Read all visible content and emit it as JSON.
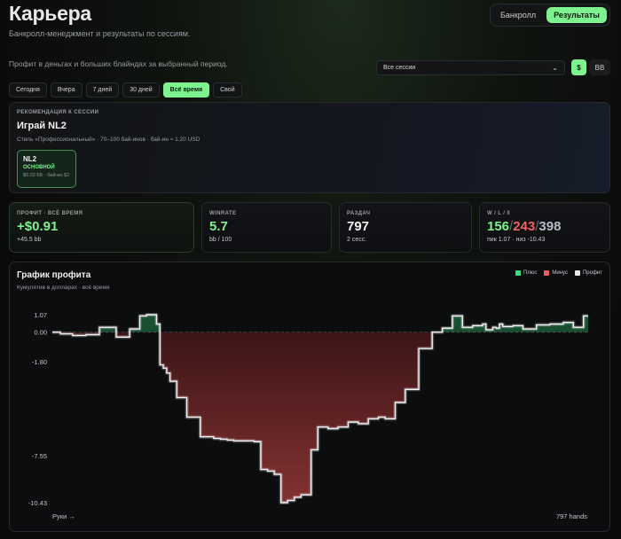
{
  "header": {
    "title": "Карьера",
    "subtitle": "Банкролл-менеджмент и результаты по сессиям.",
    "nav": [
      {
        "label": "Банкролл",
        "active": false
      },
      {
        "label": "Результаты",
        "active": true
      }
    ]
  },
  "filters": {
    "description": "Профит в деньгах и больших блайндах за выбранный период.",
    "session_select": "Все сессии",
    "units": {
      "dollar": "$",
      "bb": "BB",
      "selected": "$"
    },
    "periods": [
      {
        "label": "Сегодня",
        "active": false
      },
      {
        "label": "Вчера",
        "active": false
      },
      {
        "label": "7 дней",
        "active": false
      },
      {
        "label": "30 дней",
        "active": false
      },
      {
        "label": "Всё время",
        "active": true
      },
      {
        "label": "Свой",
        "active": false
      }
    ]
  },
  "recommendation": {
    "label": "РЕКОМЕНДАЦИЯ К СЕССИИ",
    "headline": "Играй NL2",
    "style": "Стиль «Профессиональный» · 70–100 бай-инов · бай-ин ≈ 1.20 USD",
    "limit": {
      "name": "NL2",
      "badge": "ОСНОВНОЙ",
      "blinds": "$0.02 ББ · бай-ин $2"
    }
  },
  "stats": {
    "profit": {
      "label": "ПРОФИТ · ВСЁ ВРЕМЯ",
      "value": "+$0.91",
      "sub": "+45.5 bb"
    },
    "winrate": {
      "label": "WINRATE",
      "value": "5.7",
      "sub": "bb / 100"
    },
    "hands": {
      "label": "РАЗДАЧ",
      "value": "797",
      "sub": "2 сесс."
    },
    "wl": {
      "label": "W / L / 0",
      "wins": "156",
      "losses": "243",
      "total": "398",
      "sep": "/",
      "sub": "пик 1.07 · низ -10.43"
    }
  },
  "chart_data": {
    "type": "line",
    "title": "График профита",
    "subtitle": "Кумулятив в долларах · всё время",
    "xlabel": "Руки →",
    "x_end_label": "797 hands",
    "legend": [
      {
        "name": "Плюс",
        "color": "#3ddc84"
      },
      {
        "name": "Минус",
        "color": "#f06262"
      },
      {
        "name": "Профит",
        "color": "#e8e8ea"
      }
    ],
    "ylim": [
      -10.43,
      1.07
    ],
    "yticks": [
      1.07,
      0.0,
      -1.8,
      -7.55,
      -10.43
    ],
    "ytick_labels": [
      "1.07",
      "0.00",
      "-1.80",
      "-7.55",
      "-10.43"
    ],
    "xlim": [
      0,
      797
    ],
    "x": [
      0,
      12,
      30,
      50,
      70,
      95,
      115,
      130,
      140,
      155,
      160,
      165,
      170,
      175,
      185,
      200,
      220,
      240,
      250,
      260,
      265,
      270,
      280,
      290,
      300,
      305,
      310,
      320,
      330,
      340,
      350,
      360,
      370,
      375,
      380,
      385,
      395,
      410,
      425,
      440,
      455,
      470,
      485,
      495,
      510,
      525,
      545,
      565,
      580,
      595,
      610,
      625,
      640,
      645,
      655,
      660,
      665,
      670,
      685,
      700,
      720,
      740,
      760,
      775,
      790,
      797
    ],
    "y": [
      0.0,
      -0.1,
      -0.2,
      -0.15,
      0.3,
      -0.3,
      0.2,
      1.0,
      1.07,
      0.5,
      -2.0,
      -2.2,
      -2.5,
      -3.0,
      -4.0,
      -5.2,
      -6.4,
      -6.5,
      -6.55,
      -6.6,
      -6.6,
      -6.65,
      -6.65,
      -6.65,
      -6.7,
      -6.7,
      -8.4,
      -8.5,
      -8.7,
      -10.43,
      -10.3,
      -10.1,
      -9.95,
      -9.95,
      -9.95,
      -7.2,
      -5.8,
      -5.9,
      -5.8,
      -5.5,
      -5.6,
      -5.3,
      -5.2,
      -5.3,
      -4.3,
      -3.5,
      -1.0,
      0.0,
      0.25,
      1.0,
      0.3,
      0.4,
      0.5,
      0.15,
      0.3,
      0.25,
      0.5,
      0.35,
      0.4,
      0.2,
      0.45,
      0.5,
      0.6,
      0.3,
      1.0,
      1.0
    ]
  }
}
